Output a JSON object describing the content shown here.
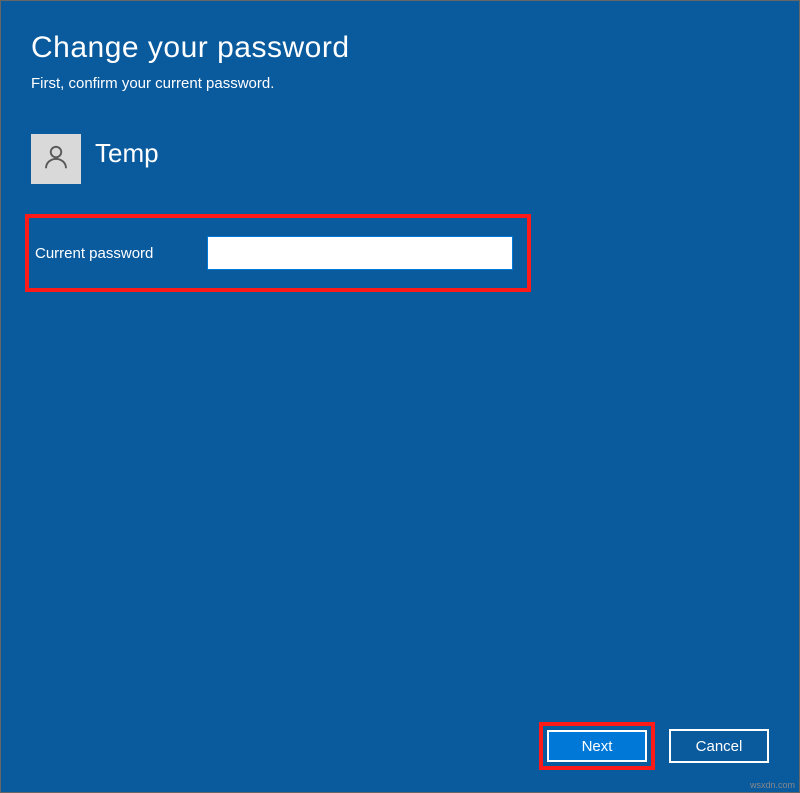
{
  "dialog": {
    "title": "Change your password",
    "subtitle": "First, confirm your current password."
  },
  "user": {
    "name": "Temp"
  },
  "field": {
    "label": "Current password",
    "value": ""
  },
  "buttons": {
    "next": "Next",
    "cancel": "Cancel"
  },
  "watermark": "wsxdn.com"
}
